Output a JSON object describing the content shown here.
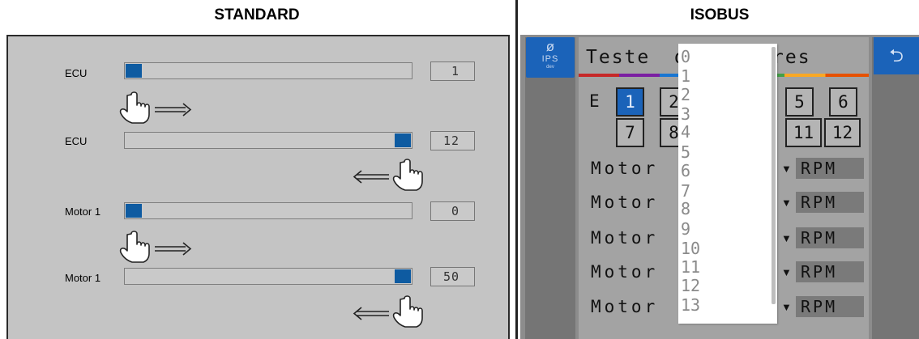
{
  "headers": {
    "standard": "STANDARD",
    "isobus": "ISOBUS"
  },
  "standard": {
    "rows": [
      {
        "label": "ECU",
        "value": "1",
        "position": 0.0
      },
      {
        "label": "ECU",
        "value": "12",
        "position": 1.0
      },
      {
        "label": "Motor 1",
        "value": "0",
        "position": 0.0
      },
      {
        "label": "Motor 1",
        "value": "50",
        "position": 1.0
      }
    ],
    "gestures": [
      "drag-right",
      "drag-left",
      "drag-right",
      "drag-left"
    ]
  },
  "isobus": {
    "logo": {
      "icon": "leaf-icon",
      "text": "IPS",
      "subtext": "dev"
    },
    "back_icon": "back-arrow-icon",
    "title_start": "Teste",
    "title_fragment_1": "d",
    "title_fragment_2": "res",
    "ecu_label": "E",
    "ecu_buttons_row1": [
      "1",
      "2",
      "5",
      "6"
    ],
    "ecu_buttons_row2": [
      "7",
      "8",
      "11",
      "12"
    ],
    "active_ecu": "1",
    "motor_rows": [
      {
        "label": "Motor",
        "unit": "RPM"
      },
      {
        "label": "Motor",
        "unit": "RPM"
      },
      {
        "label": "Motor",
        "unit": "RPM"
      },
      {
        "label": "Motor",
        "unit": "RPM"
      },
      {
        "label": "Motor",
        "unit": "RPM"
      }
    ],
    "dropdown_options": [
      "0",
      "1",
      "2",
      "3",
      "4",
      "5",
      "6",
      "7",
      "8",
      "9",
      "10",
      "11",
      "12",
      "13"
    ],
    "colors": {
      "accent": "#1b63b9",
      "thumb": "#0e5ba1"
    }
  }
}
